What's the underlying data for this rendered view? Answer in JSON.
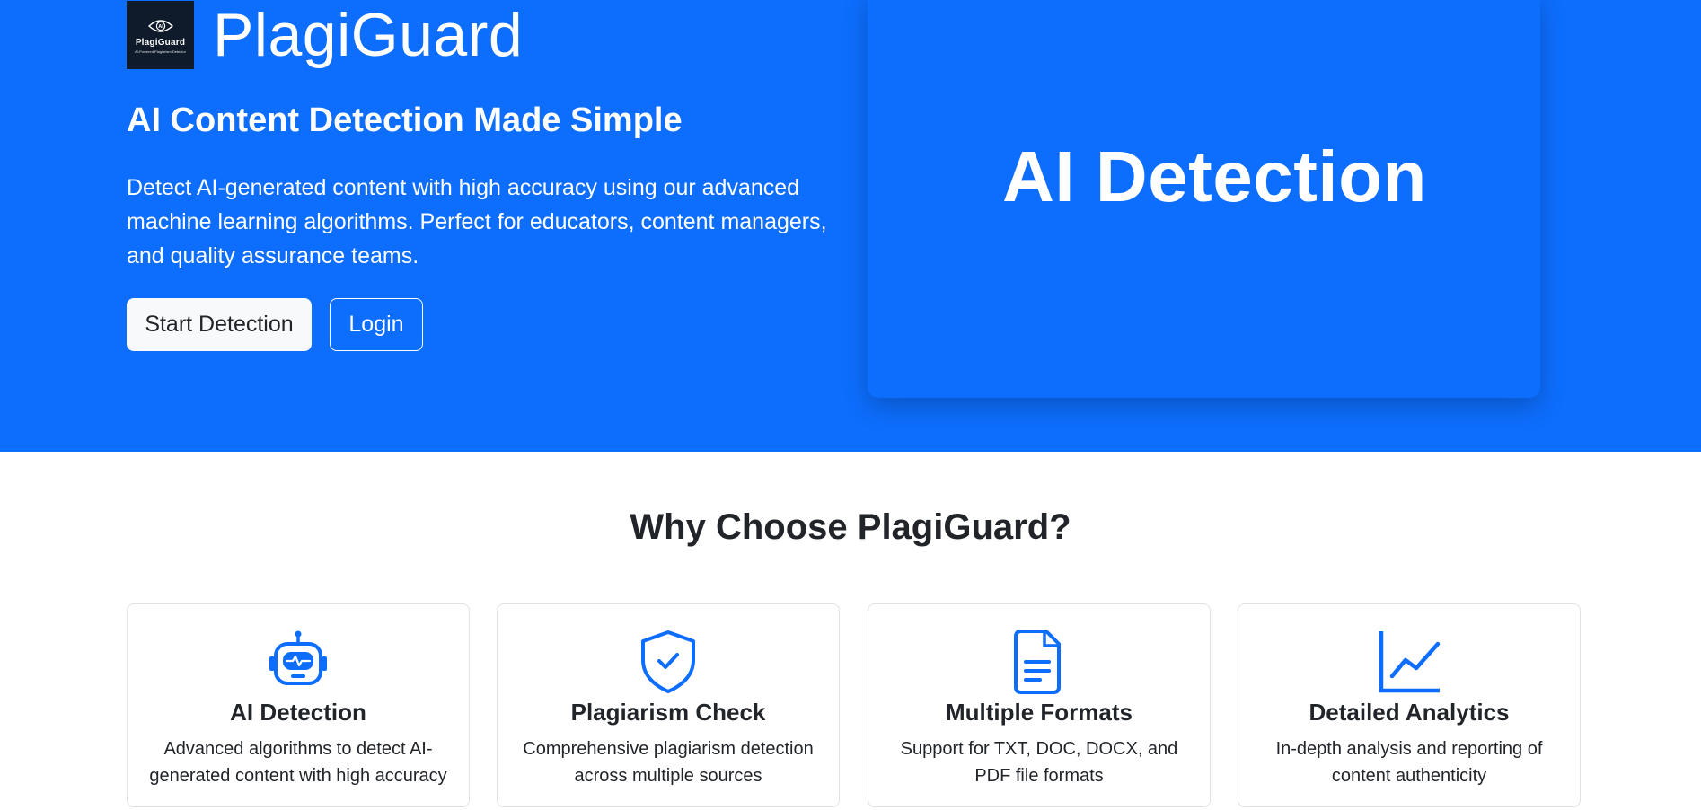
{
  "brand": {
    "name": "PlagiGuard",
    "logo_name": "PlagiGuard",
    "logo_tagline": "AI-Powered Plagiarism Detector",
    "logo_icon": "eye-ai-icon"
  },
  "hero": {
    "heading": "AI Content Detection Made Simple",
    "description": "Detect AI-generated content with high accuracy using our advanced machine learning algorithms. Perfect for educators, content managers, and quality assurance teams.",
    "primary_button": "Start Detection",
    "secondary_button": "Login",
    "card_title": "AI Detection"
  },
  "features": {
    "title": "Why Choose PlagiGuard?",
    "items": [
      {
        "icon": "robot-icon",
        "title": "AI Detection",
        "text": "Advanced algorithms to detect AI-generated content with high accuracy"
      },
      {
        "icon": "shield-check-icon",
        "title": "Plagiarism Check",
        "text": "Comprehensive plagiarism detection across multiple sources"
      },
      {
        "icon": "document-icon",
        "title": "Multiple Formats",
        "text": "Support for TXT, DOC, DOCX, and PDF file formats"
      },
      {
        "icon": "line-chart-icon",
        "title": "Detailed Analytics",
        "text": "In-depth analysis and reporting of content authenticity"
      }
    ]
  },
  "colors": {
    "primary": "#0d6efd",
    "logo_background": "#0f1b2b",
    "text_dark": "#212529",
    "button_light": "#f8f9fa"
  }
}
